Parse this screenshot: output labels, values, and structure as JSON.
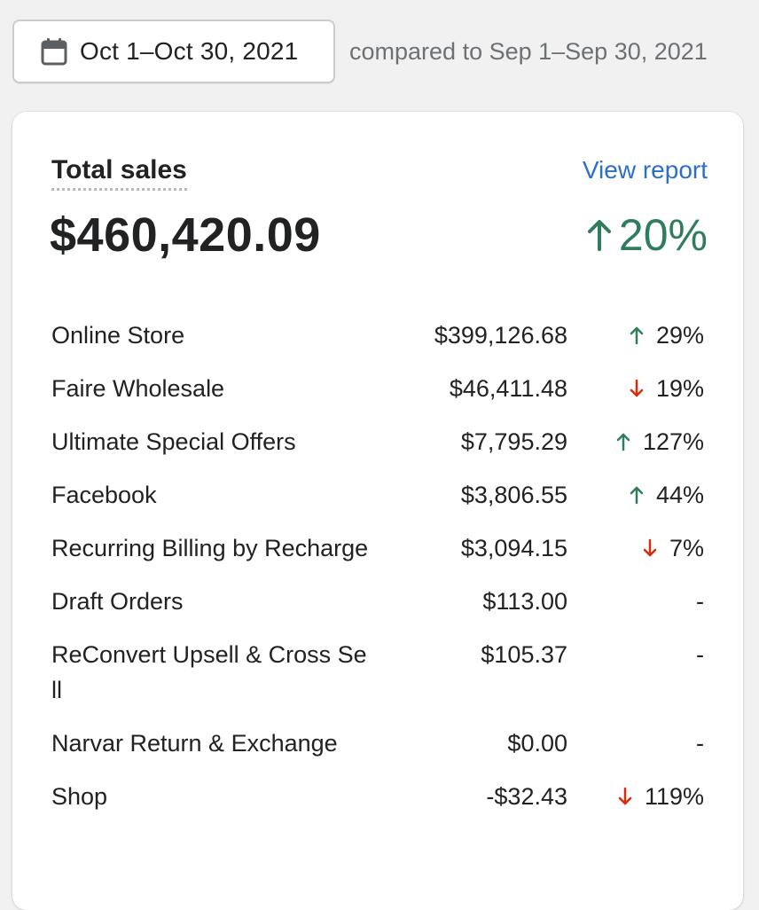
{
  "date_range": {
    "label": "Oct 1–Oct 30, 2021",
    "icon": "calendar-icon",
    "compare_text": "compared to Sep 1–Sep 30, 2021"
  },
  "card": {
    "title": "Total sales",
    "view_report": "View report",
    "total": "$460,420.09",
    "total_change": "20%",
    "total_direction": "up"
  },
  "colors": {
    "up": "#2f7d5b",
    "down": "#d72c0d",
    "link": "#2c6ecb"
  },
  "rows": [
    {
      "name": "Online Store",
      "amount": "$399,126.68",
      "direction": "up",
      "change": "29%"
    },
    {
      "name": "Faire Wholesale",
      "amount": "$46,411.48",
      "direction": "down",
      "change": "19%"
    },
    {
      "name": "Ultimate Special Offers",
      "amount": "$7,795.29",
      "direction": "up",
      "change": "127%"
    },
    {
      "name": "Facebook",
      "amount": "$3,806.55",
      "direction": "up",
      "change": "44%"
    },
    {
      "name": "Recurring Billing by Recharge",
      "amount": "$3,094.15",
      "direction": "down",
      "change": "7%"
    },
    {
      "name": "Draft Orders",
      "amount": "$113.00",
      "direction": "none",
      "change": "-"
    },
    {
      "name": "ReConvert Upsell & Cross Sell",
      "amount": "$105.37",
      "direction": "none",
      "change": "-"
    },
    {
      "name": "Narvar Return & Exchange",
      "amount": "$0.00",
      "direction": "none",
      "change": "-"
    },
    {
      "name": "Shop",
      "amount": "-$32.43",
      "direction": "down",
      "change": "119%"
    }
  ]
}
